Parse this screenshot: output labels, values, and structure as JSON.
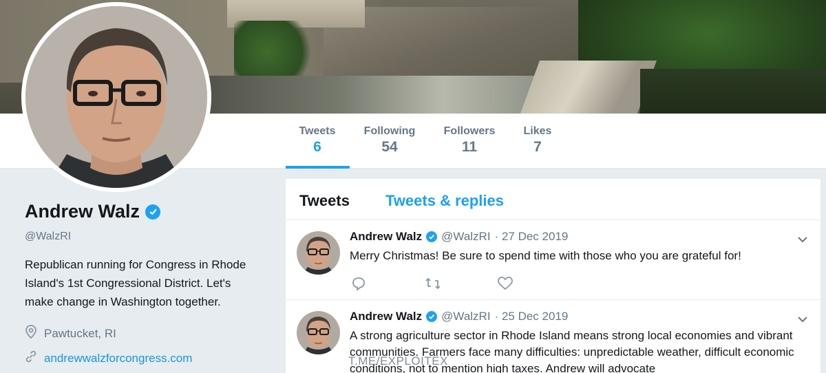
{
  "nav": {
    "items": [
      {
        "label": "Tweets",
        "value": "6"
      },
      {
        "label": "Following",
        "value": "54"
      },
      {
        "label": "Followers",
        "value": "11"
      },
      {
        "label": "Likes",
        "value": "7"
      }
    ],
    "active_color": "#1da1f2"
  },
  "profile": {
    "name": "Andrew Walz",
    "handle": "@WalzRI",
    "bio": "Republican running for Congress in Rhode Island's 1st Congressional District. Let's make change in Washington together.",
    "location": "Pawtucket, RI",
    "website": "andrewwalzforcongress.com"
  },
  "timeline": {
    "tabs": [
      "Tweets",
      "Tweets & replies"
    ],
    "tweets": [
      {
        "name": "Andrew Walz",
        "handle": "@WalzRI",
        "date": "· 27 Dec 2019",
        "text": "Merry Christmas! Be sure to spend time with those who you are grateful for!"
      },
      {
        "name": "Andrew Walz",
        "handle": "@WalzRI",
        "date": "· 25 Dec 2019",
        "text": "A strong agriculture sector in Rhode Island means strong local economies and vibrant communities. Farmers face many difficulties: unpredictable weather, difficult economic conditions, not to mention high taxes. Andrew will advocate"
      }
    ]
  },
  "watermark": "T.ME/EXPLOITEX",
  "icons": {
    "verified": "verified-badge-icon",
    "location": "location-pin-icon",
    "link": "link-icon",
    "reply": "reply-icon",
    "retweet": "retweet-icon",
    "like": "heart-icon",
    "more": "chevron-down-icon"
  }
}
